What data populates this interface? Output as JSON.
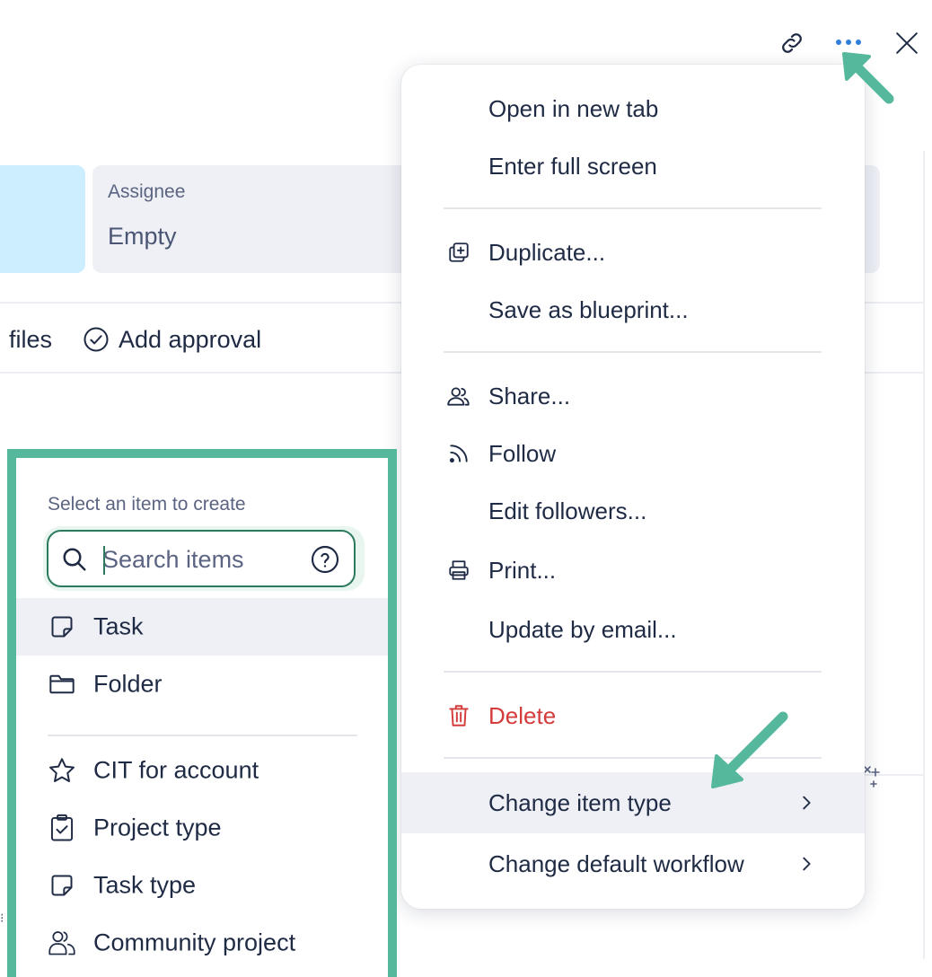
{
  "assignee": {
    "label": "Assignee",
    "value": "Empty"
  },
  "actions": {
    "files_label": "files",
    "add_approval_label": "Add approval"
  },
  "top_icons": {
    "link": "link-icon",
    "more": "more-horizontal-icon",
    "close": "close-icon"
  },
  "menu": {
    "items": [
      {
        "label": "Open in new tab",
        "icon": ""
      },
      {
        "label": "Enter full screen",
        "icon": ""
      },
      {
        "label": "Duplicate...",
        "icon": "duplicate-icon"
      },
      {
        "label": "Save as blueprint...",
        "icon": ""
      },
      {
        "label": "Share...",
        "icon": "share-people-icon"
      },
      {
        "label": "Follow",
        "icon": "follow-rss-icon"
      },
      {
        "label": "Edit followers...",
        "icon": ""
      },
      {
        "label": "Print...",
        "icon": "printer-icon"
      },
      {
        "label": "Update by email...",
        "icon": ""
      },
      {
        "label": "Delete",
        "icon": "trash-icon"
      },
      {
        "label": "Change item type",
        "icon": "",
        "submenu": true,
        "highlighted": true
      },
      {
        "label": "Change default workflow",
        "icon": "",
        "submenu": true
      }
    ]
  },
  "create_panel": {
    "title": "Select an item to create",
    "search": {
      "placeholder": "Search items",
      "value": ""
    },
    "items": [
      {
        "label": "Task",
        "icon": "task-note-icon",
        "highlighted": true
      },
      {
        "label": "Folder",
        "icon": "folder-icon"
      },
      {
        "label": "CIT for account",
        "icon": "star-icon"
      },
      {
        "label": "Project type",
        "icon": "clipboard-check-icon"
      },
      {
        "label": "Task type",
        "icon": "task-note-icon"
      },
      {
        "label": "Community project",
        "icon": "community-people-icon"
      }
    ]
  },
  "colors": {
    "accent": "#55b89c",
    "menu_highlight": "#eef0f6",
    "danger": "#d43b3b",
    "field_blue": "#cdeefe",
    "field_gray": "#eef0f6",
    "more_icon": "#2f7ed8"
  }
}
